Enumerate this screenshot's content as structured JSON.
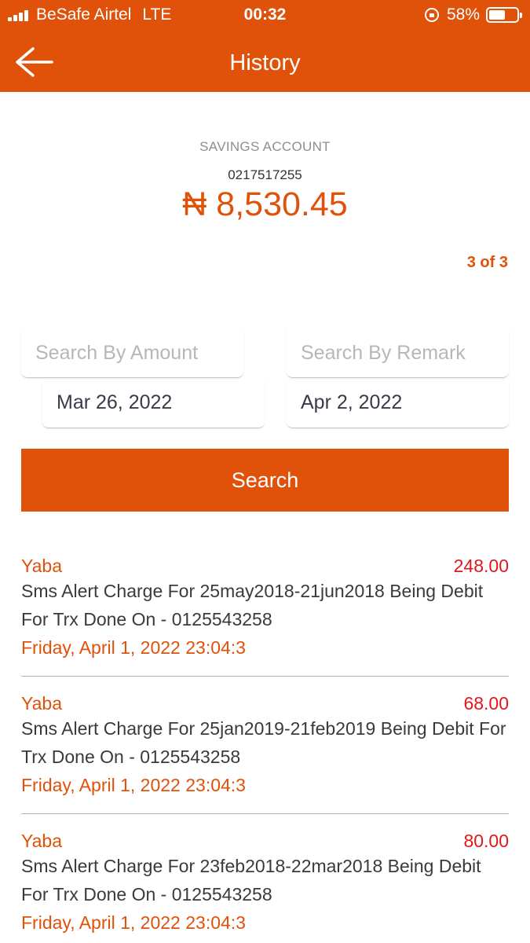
{
  "status_bar": {
    "carrier": "BeSafe Airtel",
    "network": "LTE",
    "time": "00:32",
    "battery": "58%",
    "battery_level": 0.58
  },
  "header": {
    "title": "History",
    "back_icon": "arrow-left-icon"
  },
  "account": {
    "type": "SAVINGS ACCOUNT",
    "number": "0217517255",
    "balance": "₦ 8,530.45"
  },
  "pager": "3 of 3",
  "filters": {
    "amount_placeholder": "Search By Amount",
    "remark_placeholder": "Search By Remark",
    "start_date": "Mar 26, 2022",
    "end_date": "Apr 2, 2022",
    "search_label": "Search"
  },
  "transactions": [
    {
      "branch": "Yaba",
      "amount": "248.00",
      "description": "Sms Alert Charge For 25may2018-21jun2018 Being Debit For Trx Done On - 0125543258",
      "date": "Friday, April 1, 2022 23:04:3"
    },
    {
      "branch": "Yaba",
      "amount": "68.00",
      "description": "Sms Alert Charge For 25jan2019-21feb2019 Being Debit For Trx Done On - 0125543258",
      "date": "Friday, April 1, 2022 23:04:3"
    },
    {
      "branch": "Yaba",
      "amount": "80.00",
      "description": "Sms Alert Charge For 23feb2018-22mar2018 Being Debit For Trx Done On - 0125543258",
      "date": "Friday, April 1, 2022 23:04:3"
    }
  ],
  "colors": {
    "brand": "#e0510a",
    "debit": "#e3161c"
  }
}
